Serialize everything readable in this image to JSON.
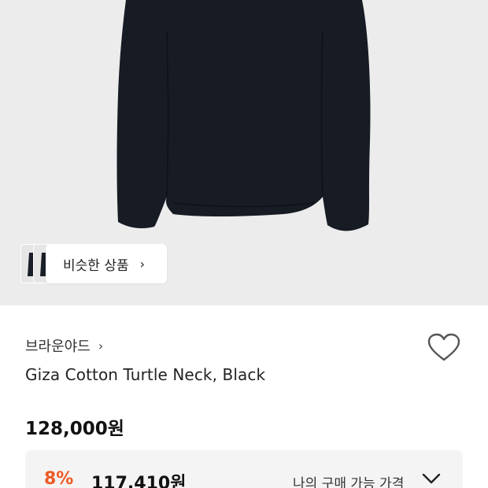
{
  "similar": {
    "label": "비슷한 상품",
    "chevron": "›"
  },
  "product": {
    "brand": "브라운야드",
    "brand_chevron": "›",
    "title": "Giza Cotton Turtle Neck, Black",
    "price": "128,000원"
  },
  "promo": {
    "rate": "8%",
    "price": "117,410원",
    "label": "나의 구매 가능 가격"
  },
  "icons": {
    "wishlist": "heart-outline-icon",
    "expand": "chevron-down-icon",
    "brand_link": "chevron-right-icon"
  },
  "colors": {
    "accent": "#ee5a24",
    "hero_bg": "#ececec",
    "garment": "#171c24"
  }
}
